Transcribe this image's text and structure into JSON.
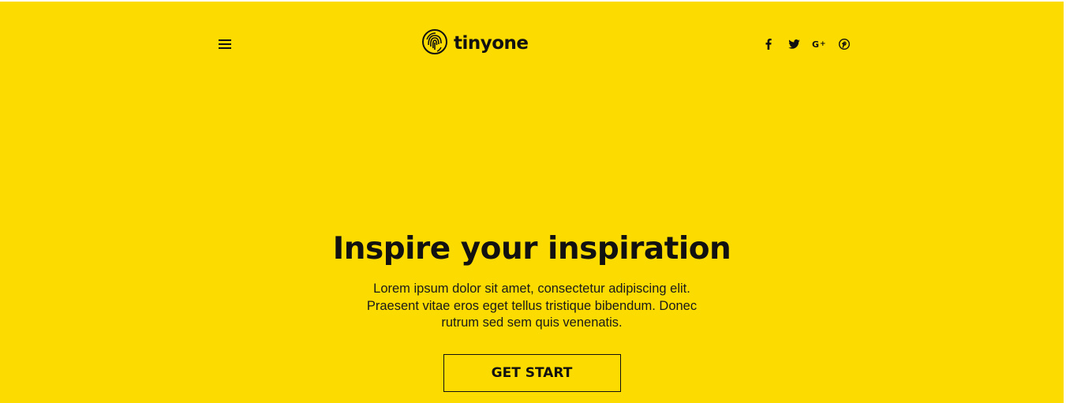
{
  "header": {
    "menu_icon": "hamburger-menu-icon",
    "logo_icon": "fingerprint-icon",
    "logo_text": "tinyone",
    "social": [
      {
        "name": "facebook-icon",
        "glyph": "f"
      },
      {
        "name": "twitter-icon",
        "glyph": "twitter"
      },
      {
        "name": "google-plus-icon",
        "glyph": "G+"
      },
      {
        "name": "pinterest-icon",
        "glyph": "pinterest"
      }
    ]
  },
  "hero": {
    "title": "Inspire your inspiration",
    "description": "Lorem ipsum dolor sit amet, consectetur adipiscing elit. Praesent vitae eros eget tellus tristique bibendum. Donec rutrum sed sem quis venenatis.",
    "cta_label": "GET START"
  },
  "colors": {
    "background": "#fcdb00",
    "text": "#111111"
  }
}
